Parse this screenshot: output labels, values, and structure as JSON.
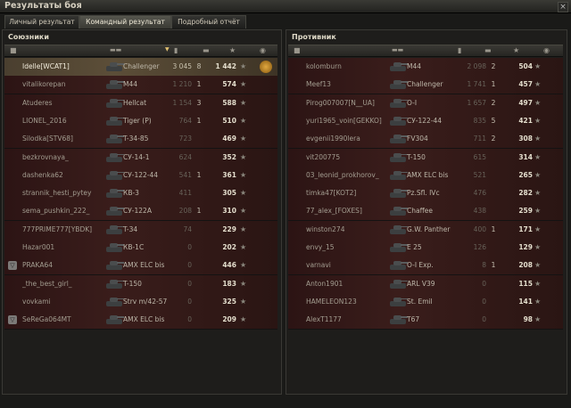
{
  "window": {
    "title": "Результаты боя",
    "close_glyph": "×"
  },
  "tabs": [
    {
      "label": "Личный результат",
      "active": false
    },
    {
      "label": "Командный результат",
      "active": true
    },
    {
      "label": "Подробный отчёт",
      "active": false
    }
  ],
  "allies": {
    "title": "Союзники",
    "rows": [
      {
        "name": "Idelle[WCAT1]",
        "tank": "Challenger",
        "damage": "3 045",
        "kills": "8",
        "xp": "1 442",
        "player": true,
        "medal": true
      },
      {
        "name": "vitalikorepan",
        "tank": "M44",
        "damage": "1 210",
        "kills": "1",
        "xp": "574"
      },
      {
        "name": "Atuderes",
        "tank": "Hellcat",
        "damage": "1 154",
        "kills": "3",
        "xp": "588"
      },
      {
        "name": "LIONEL_2016",
        "tank": "Tiger (P)",
        "damage": "764",
        "kills": "1",
        "xp": "510"
      },
      {
        "name": "Silodka[STV68]",
        "tank": "T-34-85",
        "damage": "723",
        "kills": "",
        "xp": "469"
      },
      {
        "name": "bezkrovnaya_",
        "tank": "СУ-14-1",
        "damage": "624",
        "kills": "",
        "xp": "352"
      },
      {
        "name": "dashenka62",
        "tank": "СУ-122-44",
        "damage": "541",
        "kills": "1",
        "xp": "361"
      },
      {
        "name": "strannik_hesti_pytey",
        "tank": "КВ-3",
        "damage": "411",
        "kills": "",
        "xp": "305"
      },
      {
        "name": "sema_pushkin_222_",
        "tank": "СУ-122А",
        "damage": "208",
        "kills": "1",
        "xp": "310"
      },
      {
        "name": "777PRIME777[YBDK]",
        "tank": "T-34",
        "damage": "74",
        "kills": "",
        "xp": "229"
      },
      {
        "name": "Hazar001",
        "tank": "КВ-1С",
        "damage": "0",
        "kills": "",
        "xp": "202"
      },
      {
        "name": "PRAKA64",
        "tank": "AMX ELC bis",
        "damage": "0",
        "kills": "",
        "xp": "446",
        "badge": true
      },
      {
        "name": "_the_best_girl_",
        "tank": "T-150",
        "damage": "0",
        "kills": "",
        "xp": "183"
      },
      {
        "name": "vovkami",
        "tank": "Strv m/42-57",
        "damage": "0",
        "kills": "",
        "xp": "325"
      },
      {
        "name": "SeReGa064MT",
        "tank": "AMX ELC bis",
        "damage": "0",
        "kills": "",
        "xp": "209",
        "badge": true
      }
    ]
  },
  "enemies": {
    "title": "Противник",
    "rows": [
      {
        "name": "kolomburn",
        "tank": "M44",
        "damage": "2 098",
        "kills": "2",
        "xp": "504"
      },
      {
        "name": "Meef13",
        "tank": "Challenger",
        "damage": "1 741",
        "kills": "1",
        "xp": "457"
      },
      {
        "name": "Pirog007007[N__UA]",
        "tank": "O-I",
        "damage": "1 657",
        "kills": "2",
        "xp": "497"
      },
      {
        "name": "yuri1965_voin[GEKKO]",
        "tank": "СУ-122-44",
        "damage": "835",
        "kills": "5",
        "xp": "421"
      },
      {
        "name": "evgenii1990lera",
        "tank": "FV304",
        "damage": "711",
        "kills": "2",
        "xp": "308"
      },
      {
        "name": "vit200775",
        "tank": "T-150",
        "damage": "615",
        "kills": "",
        "xp": "314"
      },
      {
        "name": "03_leonid_prokhorov_",
        "tank": "AMX ELC bis",
        "damage": "521",
        "kills": "",
        "xp": "265"
      },
      {
        "name": "timka47[KOT2]",
        "tank": "Pz.Sfl. IVc",
        "damage": "476",
        "kills": "",
        "xp": "282"
      },
      {
        "name": "77_alex_[FOXES]",
        "tank": "Chaffee",
        "damage": "438",
        "kills": "",
        "xp": "259"
      },
      {
        "name": "winston274",
        "tank": "G.W. Panther",
        "damage": "400",
        "kills": "1",
        "xp": "171"
      },
      {
        "name": "envy_15",
        "tank": "E 25",
        "damage": "126",
        "kills": "",
        "xp": "129"
      },
      {
        "name": "varnavi",
        "tank": "O-I Exp.",
        "damage": "8",
        "kills": "1",
        "xp": "208"
      },
      {
        "name": "Anton1901",
        "tank": "ARL V39",
        "damage": "0",
        "kills": "",
        "xp": "115"
      },
      {
        "name": "HAMELEON123",
        "tank": "St. Emil",
        "damage": "0",
        "kills": "",
        "xp": "141"
      },
      {
        "name": "AlexT1177",
        "tank": "T67",
        "damage": "0",
        "kills": "",
        "xp": "98"
      }
    ]
  },
  "icons": {
    "star": "★",
    "sort": "▼",
    "platoon": "■",
    "tank_header": "tank-silhouette-icon",
    "damage_header": "shell-icon",
    "kills_header": "tank-kill-icon",
    "xp_header": "star-icon"
  }
}
